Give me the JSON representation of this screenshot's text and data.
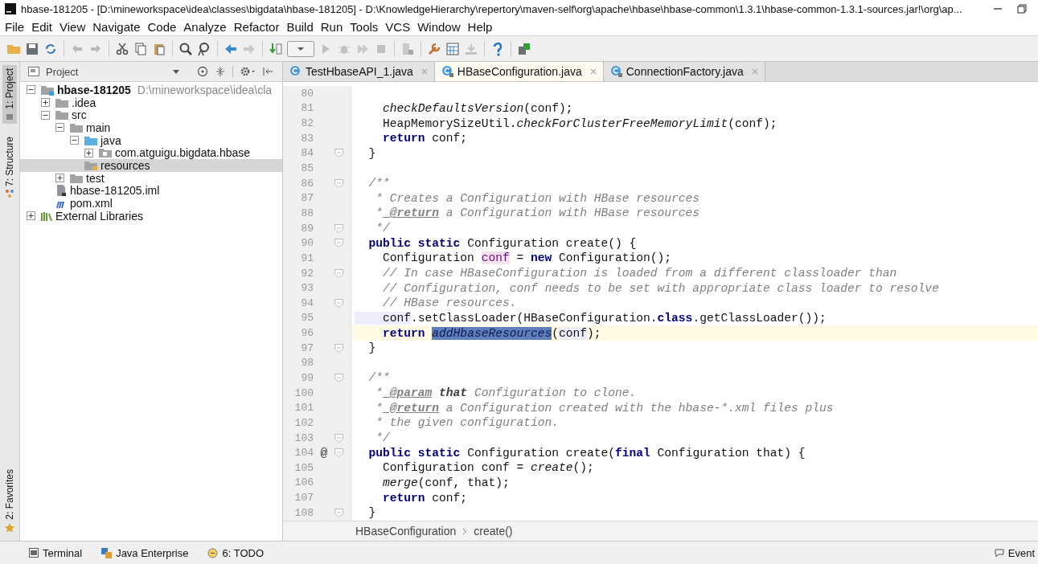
{
  "window": {
    "title": "hbase-181205 - [D:\\mineworkspace\\idea\\classes\\bigdata\\hbase-181205] - D:\\KnowledgeHierarchy\\repertory\\maven-self\\org\\apache\\hbase\\hbase-common\\1.3.1\\hbase-common-1.3.1-sources.jar!\\org\\ap..."
  },
  "menu": [
    "File",
    "Edit",
    "View",
    "Navigate",
    "Code",
    "Analyze",
    "Refactor",
    "Build",
    "Run",
    "Tools",
    "VCS",
    "Window",
    "Help"
  ],
  "side_strip": {
    "top": [
      {
        "label": "1: Project",
        "selected": true
      },
      {
        "label": "7: Structure",
        "selected": false
      }
    ],
    "bottom": [
      {
        "label": "2: Favorites",
        "selected": false
      }
    ]
  },
  "project_panel": {
    "title": "Project"
  },
  "tree": [
    {
      "label": "hbase-181205",
      "kind": "module",
      "path": "D:\\mineworkspace\\idea\\cla",
      "expanded": true,
      "selected": false,
      "children": [
        {
          "label": ".idea",
          "kind": "folder",
          "expanded": false,
          "selected": false
        },
        {
          "label": "src",
          "kind": "folder",
          "expanded": true,
          "selected": false,
          "children": [
            {
              "label": "main",
              "kind": "folder",
              "expanded": true,
              "selected": false,
              "children": [
                {
                  "label": "java",
                  "kind": "source-folder",
                  "expanded": true,
                  "selected": false,
                  "children": [
                    {
                      "label": "com.atguigu.bigdata.hbase",
                      "kind": "package",
                      "expanded": false,
                      "selected": false
                    }
                  ]
                },
                {
                  "label": "resources",
                  "kind": "resources-folder",
                  "selected": true
                }
              ]
            },
            {
              "label": "test",
              "kind": "folder",
              "expanded": false,
              "selected": false
            }
          ]
        },
        {
          "label": "hbase-181205.iml",
          "kind": "iml-file",
          "selected": false
        },
        {
          "label": "pom.xml",
          "kind": "maven-file",
          "selected": false
        }
      ]
    },
    {
      "label": "External Libraries",
      "kind": "libraries",
      "expanded": false,
      "selected": false
    }
  ],
  "tabs": [
    {
      "label": "TestHbaseAPI_1.java",
      "selected": false,
      "locked": false
    },
    {
      "label": "HBaseConfiguration.java",
      "selected": true,
      "locked": true
    },
    {
      "label": "ConnectionFactory.java",
      "selected": false,
      "locked": true
    }
  ],
  "code": [
    {
      "n": "80",
      "fold": false,
      "current": false
    },
    {
      "n": "81",
      "fold": false,
      "current": false,
      "tokens": [
        {
          "t": "    checkDefaultsVersion",
          "kind": "italic"
        },
        {
          "t": "(conf);",
          "kind": "plain"
        }
      ]
    },
    {
      "n": "82",
      "fold": false,
      "current": false,
      "tokens": [
        {
          "t": "    HeapMemorySizeUtil.",
          "kind": "plain"
        },
        {
          "t": "checkForClusterFreeMemoryLimit",
          "kind": "italic"
        },
        {
          "t": "(conf);",
          "kind": "plain"
        }
      ]
    },
    {
      "n": "83",
      "fold": false,
      "current": false,
      "tokens": [
        {
          "t": "    return",
          "kind": "keyword"
        },
        {
          "t": " conf;",
          "kind": "plain"
        }
      ]
    },
    {
      "n": "84",
      "fold": true,
      "current": false,
      "tokens": [
        {
          "t": "  }",
          "kind": "plain"
        }
      ]
    },
    {
      "n": "85",
      "fold": false,
      "current": false
    },
    {
      "n": "86",
      "fold": true,
      "current": false,
      "tokens": [
        {
          "t": "  /**",
          "kind": "comment"
        }
      ]
    },
    {
      "n": "87",
      "fold": false,
      "current": false,
      "tokens": [
        {
          "t": "   * Creates a Configuration with HBase resources",
          "kind": "comment"
        }
      ]
    },
    {
      "n": "88",
      "fold": false,
      "current": false,
      "tokens": [
        {
          "t": "   *",
          "kind": "comment"
        },
        {
          "t": " @return",
          "kind": "doc-tag"
        },
        {
          "t": " a Configuration with HBase resources",
          "kind": "comment"
        }
      ]
    },
    {
      "n": "89",
      "fold": true,
      "current": false,
      "tokens": [
        {
          "t": "   */",
          "kind": "comment"
        }
      ]
    },
    {
      "n": "90",
      "fold": true,
      "current": false,
      "tokens": [
        {
          "t": "  public static",
          "kind": "keyword"
        },
        {
          "t": " Configuration create() {",
          "kind": "plain"
        }
      ]
    },
    {
      "n": "91",
      "fold": false,
      "current": false,
      "tokens": [
        {
          "t": "    Configuration ",
          "kind": "plain"
        },
        {
          "t": "conf",
          "kind": "declaration"
        },
        {
          "t": " = ",
          "kind": "plain"
        },
        {
          "t": "new",
          "kind": "keyword"
        },
        {
          "t": " Configuration();",
          "kind": "plain"
        }
      ]
    },
    {
      "n": "92",
      "fold": true,
      "current": false,
      "tokens": [
        {
          "t": "    // In case HBaseConfiguration is loaded from a different classloader than",
          "kind": "comment"
        }
      ]
    },
    {
      "n": "93",
      "fold": false,
      "current": false,
      "tokens": [
        {
          "t": "    // Configuration, conf needs to be set with appropriate class loader to resolve",
          "kind": "comment"
        }
      ]
    },
    {
      "n": "94",
      "fold": true,
      "current": false,
      "tokens": [
        {
          "t": "    // HBase resources.",
          "kind": "comment"
        }
      ]
    },
    {
      "n": "95",
      "fold": false,
      "current": false,
      "tokens": [
        {
          "t": "    conf",
          "kind": "usage"
        },
        {
          "t": ".setClassLoader(HBaseConfiguration.",
          "kind": "plain"
        },
        {
          "t": "class",
          "kind": "keyword"
        },
        {
          "t": ".getClassLoader());",
          "kind": "plain"
        }
      ]
    },
    {
      "n": "96",
      "fold": false,
      "current": true,
      "tokens": [
        {
          "t": "    return ",
          "kind": "keyword"
        },
        {
          "t": "addHbaseResources",
          "kind": "selected"
        },
        {
          "t": "(",
          "kind": "plain"
        },
        {
          "t": "conf",
          "kind": "usage"
        },
        {
          "t": ");",
          "kind": "plain"
        }
      ]
    },
    {
      "n": "97",
      "fold": true,
      "current": false,
      "tokens": [
        {
          "t": "  }",
          "kind": "plain"
        }
      ]
    },
    {
      "n": "98",
      "fold": false,
      "current": false
    },
    {
      "n": "99",
      "fold": true,
      "current": false,
      "tokens": [
        {
          "t": "  /**",
          "kind": "comment"
        }
      ]
    },
    {
      "n": "100",
      "fold": false,
      "current": false,
      "tokens": [
        {
          "t": "   *",
          "kind": "comment"
        },
        {
          "t": " @param",
          "kind": "doc-tag"
        },
        {
          "t": " that",
          "kind": "bold"
        },
        {
          "t": " Configuration to clone.",
          "kind": "comment"
        }
      ]
    },
    {
      "n": "101",
      "fold": false,
      "current": false,
      "tokens": [
        {
          "t": "   *",
          "kind": "comment"
        },
        {
          "t": " @return",
          "kind": "doc-tag"
        },
        {
          "t": " a Configuration created with the hbase-*.xml files plus",
          "kind": "comment"
        }
      ]
    },
    {
      "n": "102",
      "fold": false,
      "current": false,
      "tokens": [
        {
          "t": "   * the given configuration.",
          "kind": "comment"
        }
      ]
    },
    {
      "n": "103",
      "fold": true,
      "current": false,
      "tokens": [
        {
          "t": "   */",
          "kind": "comment"
        }
      ]
    },
    {
      "n": "104",
      "fold": true,
      "current": false,
      "marker": "@",
      "tokens": [
        {
          "t": "  public static",
          "kind": "keyword"
        },
        {
          "t": " Configuration create(",
          "kind": "plain"
        },
        {
          "t": "final",
          "kind": "keyword"
        },
        {
          "t": " Configuration that) {",
          "kind": "plain"
        }
      ]
    },
    {
      "n": "105",
      "fold": false,
      "current": false,
      "tokens": [
        {
          "t": "    Configuration conf = ",
          "kind": "plain"
        },
        {
          "t": "create",
          "kind": "italic"
        },
        {
          "t": "();",
          "kind": "plain"
        }
      ]
    },
    {
      "n": "106",
      "fold": false,
      "current": false,
      "tokens": [
        {
          "t": "    merge",
          "kind": "italic"
        },
        {
          "t": "(conf, that);",
          "kind": "plain"
        }
      ]
    },
    {
      "n": "107",
      "fold": false,
      "current": false,
      "tokens": [
        {
          "t": "    return",
          "kind": "keyword"
        },
        {
          "t": " conf;",
          "kind": "plain"
        }
      ]
    },
    {
      "n": "108",
      "fold": true,
      "current": false,
      "tokens": [
        {
          "t": "  }",
          "kind": "plain"
        }
      ]
    }
  ],
  "breadcrumb": [
    "HBaseConfiguration",
    "create()"
  ],
  "bottom_bar": {
    "tools": [
      {
        "label": "Terminal",
        "kind": "terminal"
      },
      {
        "label": "Java Enterprise",
        "kind": "enterprise"
      },
      {
        "label": "6: TODO",
        "kind": "todo"
      }
    ],
    "right": "Event"
  }
}
